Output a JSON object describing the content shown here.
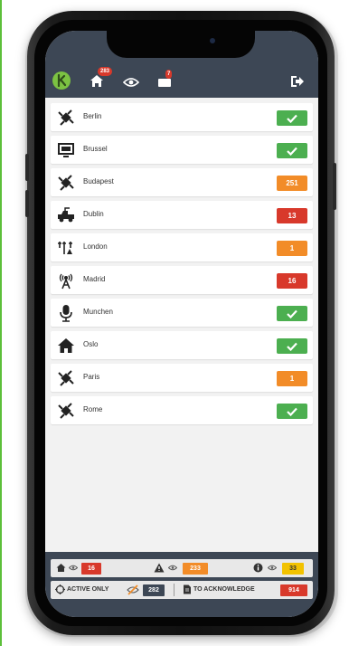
{
  "header": {
    "alarms_badge": "283",
    "messages_badge": "7"
  },
  "sites": [
    {
      "name": "Berlin",
      "icon": "satellite-icon",
      "status": "ok",
      "value": ""
    },
    {
      "name": "Brussel",
      "icon": "monitor-icon",
      "status": "ok",
      "value": ""
    },
    {
      "name": "Budapest",
      "icon": "satellite-icon",
      "status": "warning",
      "value": "251"
    },
    {
      "name": "Dublin",
      "icon": "vehicle-icon",
      "status": "critical",
      "value": "13"
    },
    {
      "name": "London",
      "icon": "antenna-tower-icon",
      "status": "warning",
      "value": "1"
    },
    {
      "name": "Madrid",
      "icon": "broadcast-icon",
      "status": "critical",
      "value": "16"
    },
    {
      "name": "Munchen",
      "icon": "microphone-icon",
      "status": "ok",
      "value": ""
    },
    {
      "name": "Oslo",
      "icon": "home-icon",
      "status": "ok",
      "value": ""
    },
    {
      "name": "Paris",
      "icon": "satellite-icon",
      "status": "warning",
      "value": "1"
    },
    {
      "name": "Rome",
      "icon": "satellite-icon",
      "status": "ok",
      "value": ""
    }
  ],
  "footer": {
    "critical_count": "16",
    "warning_count": "233",
    "info_count": "33",
    "active_only_label": "ACTIVE ONLY",
    "active_count": "282",
    "acknowledge_label": "TO ACKNOWLEDGE",
    "acknowledge_count": "914"
  },
  "colors": {
    "header_bg": "#3d4755",
    "ok": "#4caf50",
    "warning": "#f28c28",
    "critical": "#d8392b",
    "info": "#f2c200",
    "brand": "#7cc242"
  }
}
